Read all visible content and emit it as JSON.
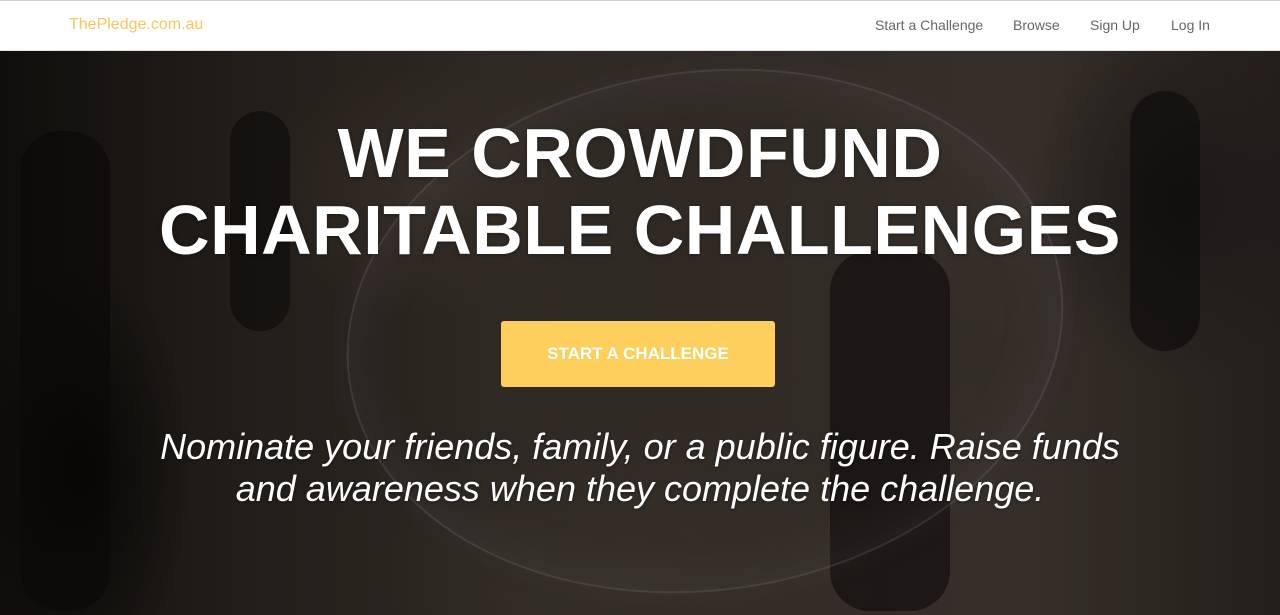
{
  "header": {
    "brand": "ThePledge.com.au",
    "nav": [
      {
        "label": "Start a Challenge"
      },
      {
        "label": "Browse"
      },
      {
        "label": "Sign Up"
      },
      {
        "label": "Log In"
      }
    ]
  },
  "hero": {
    "headline_line1": "WE CROWDFUND",
    "headline_line2": "CHARITABLE CHALLENGES",
    "cta_label": "START A CHALLENGE",
    "tagline_line1": "Nominate your friends, family, or a public figure. Raise funds",
    "tagline_line2": "and awareness when they complete the challenge."
  },
  "colors": {
    "brand": "#f7c75a",
    "cta": "#fdcf5c",
    "nav_text": "#666666"
  }
}
